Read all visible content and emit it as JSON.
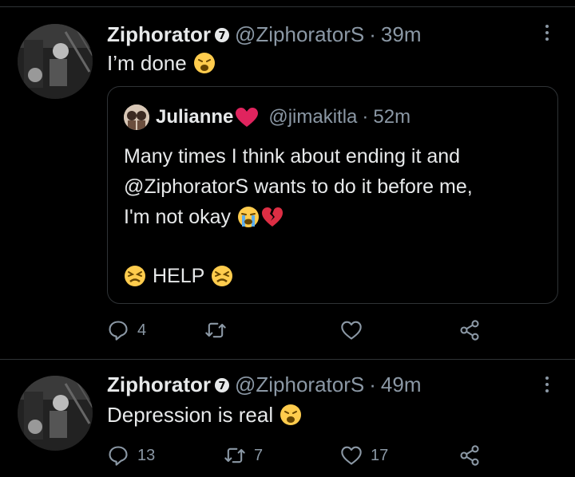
{
  "tweets": [
    {
      "name": "Ziphorator",
      "handle": "@ZiphoratorS",
      "separator": "·",
      "time": "39m",
      "text": "I’m done",
      "emoji": "weary-face-icon",
      "quote": {
        "name": "Julianne",
        "handle": "@jimakitla",
        "separator": "·",
        "time": "52m",
        "lines": [
          "Many times I think about ending it and",
          "@ZiphoratorS wants to do it before me,",
          "I'm not okay"
        ],
        "help": "HELP"
      },
      "actions": {
        "replies": "4",
        "retweets": "",
        "likes": ""
      }
    },
    {
      "name": "Ziphorator",
      "handle": "@ZiphoratorS",
      "separator": "·",
      "time": "49m",
      "text": "Depression is real",
      "emoji": "weary-face-icon",
      "actions": {
        "replies": "13",
        "retweets": "7",
        "likes": "17"
      }
    }
  ],
  "colors": {
    "background": "#000000",
    "text": "#e7e9ea",
    "muted": "#8b98a5",
    "border": "#2f3336",
    "heart": "#e0245e",
    "emoji": "#ffcc4d"
  }
}
